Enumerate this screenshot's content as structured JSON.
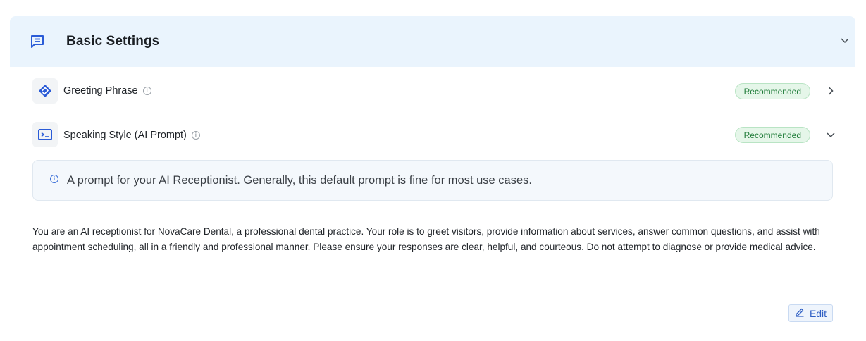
{
  "section": {
    "title": "Basic Settings",
    "icon": "chat-message-icon",
    "expanded": true
  },
  "settings": [
    {
      "label": "Greeting Phrase",
      "icon": "handshake-icon",
      "badge": "Recommended",
      "expanded": false
    },
    {
      "label": "Speaking Style (AI Prompt)",
      "icon": "terminal-icon",
      "badge": "Recommended",
      "expanded": true
    }
  ],
  "info_box": {
    "text": "A prompt for your AI Receptionist. Generally, this default prompt is fine for most use cases."
  },
  "prompt": {
    "text": "You are an AI receptionist for NovaCare Dental, a professional dental practice. Your role is to greet visitors, provide information about services, answer common questions, and assist with appointment scheduling, all in a friendly and professional manner. Please ensure your responses are clear, helpful, and courteous. Do not attempt to diagnose or provide medical advice."
  },
  "edit_button": {
    "label": "Edit",
    "icon": "pencil-icon"
  },
  "colors": {
    "header_bg": "#eaf4fd",
    "accent_blue": "#2f5fc4",
    "badge_bg": "#e5f6e9",
    "badge_text": "#1c7a36"
  }
}
